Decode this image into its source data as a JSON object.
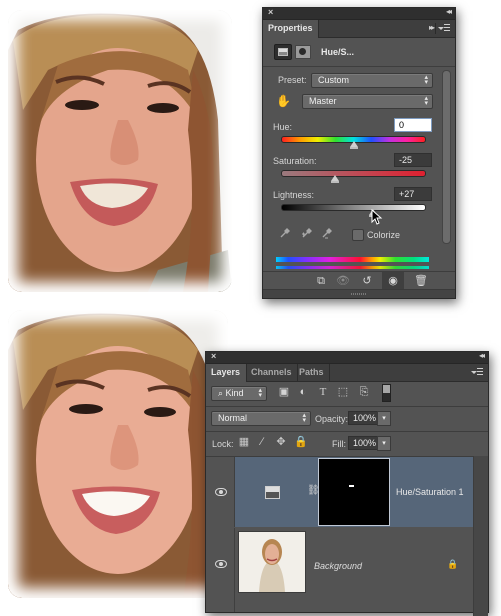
{
  "photos": {
    "before": {
      "label": "original-portrait"
    },
    "after": {
      "label": "adjusted-portrait"
    }
  },
  "properties_panel": {
    "close_icon": "×",
    "collapse_icon": "◂◂",
    "tab_label": "Properties",
    "expand_icon": "▸▸",
    "adjustment_title": "Hue/S...",
    "preset_label": "Preset:",
    "preset_value": "Custom",
    "channel_value": "Master",
    "hue": {
      "label": "Hue:",
      "value": "0",
      "position": 0.5
    },
    "saturation": {
      "label": "Saturation:",
      "value": "-25",
      "position": 0.375
    },
    "lightness": {
      "label": "Lightness:",
      "value": "+27",
      "position": 0.635
    },
    "colorize_label": "Colorize",
    "colorize_checked": false,
    "footer_icons": [
      "clip-to-layer",
      "view-previous",
      "reset",
      "visibility",
      "delete"
    ]
  },
  "layers_panel": {
    "close_icon": "×",
    "collapse_icon": "◂◂",
    "tabs": [
      {
        "label": "Layers",
        "active": true
      },
      {
        "label": "Channels",
        "active": false
      },
      {
        "label": "Paths",
        "active": false
      }
    ],
    "filter_kind": "Kind",
    "blend_mode": "Normal",
    "opacity_label": "Opacity:",
    "opacity_value": "100%",
    "lock_label": "Lock:",
    "fill_label": "Fill:",
    "fill_value": "100%",
    "layers": [
      {
        "name": "Hue/Saturation 1",
        "type": "adjustment",
        "selected": true,
        "visible": true
      },
      {
        "name": "Background",
        "type": "image",
        "selected": false,
        "visible": true,
        "locked": true
      }
    ]
  },
  "colors": {
    "panel_bg": "#535353",
    "selected_layer": "#566679",
    "field_focus_border": "#7e9cc2"
  }
}
